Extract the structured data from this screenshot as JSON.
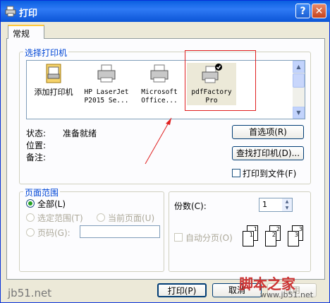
{
  "window": {
    "title": "打印",
    "help_label": "?",
    "close_label": "✕"
  },
  "tab": {
    "label": "常规"
  },
  "printer_group": {
    "legend": "选择打印机"
  },
  "printers": [
    {
      "label_line1": "添加打印机",
      "label_line2": ""
    },
    {
      "label_line1": "HP LaserJet",
      "label_line2": "P2015 Se..."
    },
    {
      "label_line1": "Microsoft",
      "label_line2": "Office..."
    },
    {
      "label_line1": "pdfFactory",
      "label_line2": "Pro"
    }
  ],
  "status": {
    "status_label": "状态:",
    "status_value": "准备就绪",
    "location_label": "位置:",
    "location_value": "",
    "comment_label": "备注:",
    "comment_value": ""
  },
  "buttons": {
    "preferences": "首选项(R)",
    "find_printer": "查找打印机(D)...",
    "print_to_file": "打印到文件(F)",
    "print": "打印(P)",
    "cancel": "取消",
    "apply": "应用"
  },
  "page_range": {
    "legend": "页面范围",
    "all": "全部(L)",
    "selection": "选定范围(T)",
    "current_page": "当前页面(U)",
    "pages": "页码(G):",
    "pages_value": ""
  },
  "copies": {
    "label": "份数(C):",
    "value": "1",
    "collate": "自动分页(O)",
    "stack1": [
      "1",
      "1"
    ],
    "stack2": [
      "2",
      "2"
    ],
    "stack3": [
      "3",
      "3"
    ]
  },
  "watermark": {
    "left": "jb51.net",
    "right": "脚本之家",
    "url": "www.jb51.net"
  }
}
